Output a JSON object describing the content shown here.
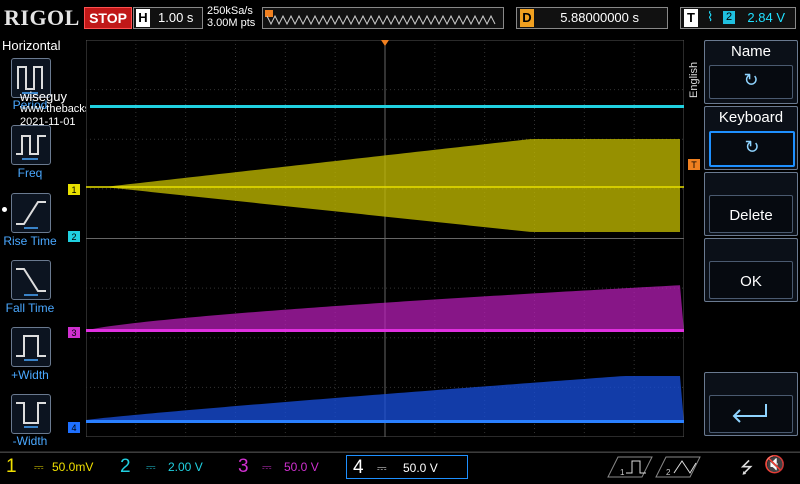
{
  "brand": "RIGOL",
  "run_state": "STOP",
  "timebase": {
    "label": "H",
    "value": "1.00 s"
  },
  "sample_rate": "250kSa/s",
  "memory_depth": "3.00M pts",
  "delay": {
    "label": "D",
    "value": "5.88000000 s"
  },
  "trigger": {
    "label": "T",
    "source": "2",
    "level": "2.84 V"
  },
  "left_menu": {
    "title": "Horizontal",
    "items": [
      {
        "label": "Period"
      },
      {
        "label": "Freq"
      },
      {
        "label": "Rise Time"
      },
      {
        "label": "Fall Time"
      },
      {
        "label": "+Width"
      },
      {
        "label": "-Width"
      }
    ]
  },
  "watermark": {
    "name": "wiseguy",
    "url": "www.thebackshed.com",
    "date": "2021-11-01"
  },
  "right_menu": {
    "language_tab": "English",
    "items": [
      {
        "label": "Name"
      },
      {
        "label": "Keyboard"
      },
      {
        "label": "Delete"
      },
      {
        "label": "OK"
      }
    ]
  },
  "trace_markers": {
    "ch1": "1",
    "ch2": "2",
    "ch3": "3",
    "ch4": "4",
    "trigger": "T"
  },
  "channels": [
    {
      "num": "1",
      "scale": "50.0mV",
      "color": "#f0e000"
    },
    {
      "num": "2",
      "scale": "2.00 V",
      "color": "#00e0f0"
    },
    {
      "num": "3",
      "scale": "50.0 V",
      "color": "#e030e0"
    },
    {
      "num": "4",
      "scale": "50.0 V",
      "color": "#1e78ff"
    }
  ],
  "colors": {
    "ch1": "#c8c000",
    "ch2": "#20d0e0",
    "ch3": "#c020c0",
    "ch4": "#1850e0",
    "accent": "#1e90ff",
    "stop": "#c01818"
  }
}
